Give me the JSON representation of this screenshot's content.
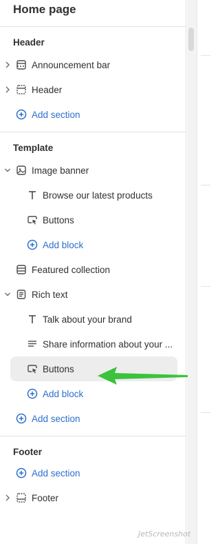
{
  "panel": {
    "title": "Home page"
  },
  "groups": {
    "header": {
      "heading": "Header",
      "items": [
        "Announcement bar",
        "Header"
      ],
      "add_section": "Add section"
    },
    "template": {
      "heading": "Template",
      "image_banner": {
        "label": "Image banner",
        "blocks": [
          "Browse our latest products",
          "Buttons"
        ],
        "add_block": "Add block"
      },
      "featured_collection": "Featured collection",
      "rich_text": {
        "label": "Rich text",
        "blocks": [
          "Talk about your brand",
          "Share information about your ...",
          "Buttons"
        ],
        "add_block": "Add block"
      },
      "add_section": "Add section"
    },
    "footer": {
      "heading": "Footer",
      "add_section": "Add section",
      "items": [
        "Footer"
      ]
    }
  },
  "watermark": "JetScreenshot",
  "colors": {
    "accent": "#2c6ecb",
    "arrow": "#3cc23c",
    "selected_bg": "#ededed",
    "text": "#303030"
  },
  "icons": {
    "section_layout": "section-layout-icon",
    "image": "image-icon",
    "text": "text-t-icon",
    "buttons": "cursor-button-icon",
    "paragraph": "paragraph-lines-icon",
    "rich_text": "document-text-icon",
    "add": "plus-circle-icon",
    "chevron": "chevron-right-icon",
    "chevron_open": "chevron-down-icon"
  }
}
